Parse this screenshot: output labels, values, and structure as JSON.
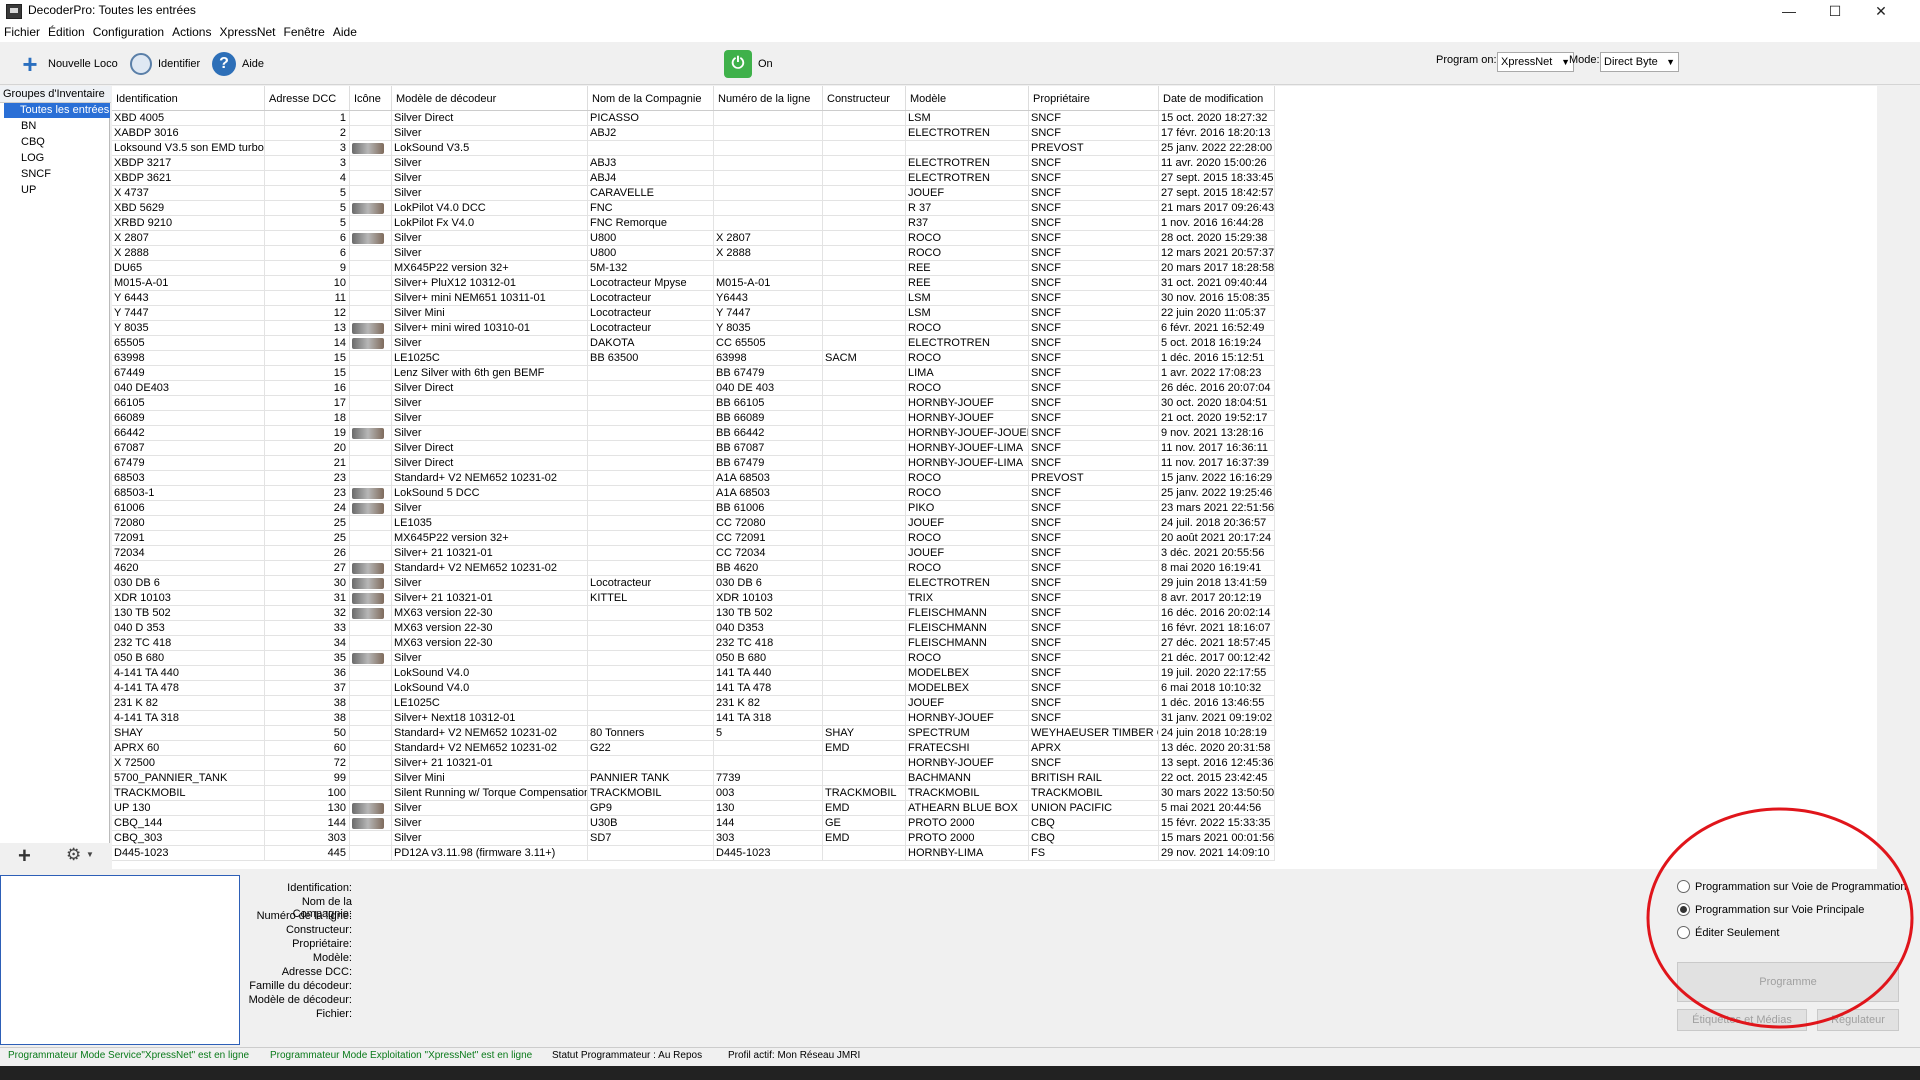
{
  "window": {
    "title": "DecoderPro: Toutes les entrées"
  },
  "menu": [
    "Fichier",
    "Édition",
    "Configuration",
    "Actions",
    "XpressNet",
    "Fenêtre",
    "Aide"
  ],
  "toolbar": {
    "new_loco": "Nouvelle Loco",
    "identify": "Identifier",
    "help": "Aide",
    "power": "On",
    "program_on_label": "Program on:",
    "program_on_value": "XpressNet",
    "mode_label": "Mode:",
    "mode_value": "Direct Byte"
  },
  "groups": {
    "header": "Groupes d'Inventaire",
    "items": [
      "Toutes les entrées",
      "BN",
      "CBQ",
      "LOG",
      "SNCF",
      "UP"
    ]
  },
  "table": {
    "columns": [
      "Identification",
      "Adresse DCC",
      "Icône",
      "Modèle de décodeur",
      "Nom de la Compagnie",
      "Numéro de la ligne",
      "Constructeur",
      "Modèle",
      "Propriétaire",
      "Date de modification"
    ],
    "rows": [
      [
        "XBD 4005",
        "1",
        "",
        "Silver Direct",
        "PICASSO",
        "",
        "",
        "LSM",
        "SNCF",
        "15 oct. 2020 18:27:32"
      ],
      [
        "XABDP 3016",
        "2",
        "",
        "Silver",
        "ABJ2",
        "",
        "",
        "ELECTROTREN",
        "SNCF",
        "17 févr. 2016 18:20:13"
      ],
      [
        "Loksound V3.5 son EMD turbo",
        "3",
        "img",
        "LokSound V3.5",
        "",
        "",
        "",
        "",
        "PREVOST",
        "25 janv. 2022 22:28:00"
      ],
      [
        "XBDP 3217",
        "3",
        "",
        "Silver",
        "ABJ3",
        "",
        "",
        "ELECTROTREN",
        "SNCF",
        "11 avr. 2020 15:00:26"
      ],
      [
        "XBDP 3621",
        "4",
        "",
        "Silver",
        "ABJ4",
        "",
        "",
        "ELECTROTREN",
        "SNCF",
        "27 sept. 2015 18:33:45"
      ],
      [
        "X 4737",
        "5",
        "",
        "Silver",
        "CARAVELLE",
        "",
        "",
        "JOUEF",
        "SNCF",
        "27 sept. 2015 18:42:57"
      ],
      [
        "XBD 5629",
        "5",
        "img",
        "LokPilot V4.0 DCC",
        "FNC",
        "",
        "",
        "R 37",
        "SNCF",
        "21 mars 2017 09:26:43"
      ],
      [
        "XRBD 9210",
        "5",
        "",
        "LokPilot Fx V4.0",
        "FNC Remorque",
        "",
        "",
        "R37",
        "SNCF",
        "1 nov. 2016 16:44:28"
      ],
      [
        "X 2807",
        "6",
        "img",
        "Silver",
        "U800",
        "X 2807",
        "",
        "ROCO",
        "SNCF",
        "28 oct. 2020 15:29:38"
      ],
      [
        "X 2888",
        "6",
        "",
        "Silver",
        "U800",
        "X 2888",
        "",
        "ROCO",
        "SNCF",
        "12 mars 2021 20:57:37"
      ],
      [
        "DU65",
        "9",
        "",
        "MX645P22 version 32+",
        "5M-132",
        "",
        "",
        "REE",
        "SNCF",
        "20 mars 2017 18:28:58"
      ],
      [
        "M015-A-01",
        "10",
        "",
        "Silver+ PluX12 10312-01",
        "Locotracteur Mpyse",
        "M015-A-01",
        "",
        "REE",
        "SNCF",
        "31 oct. 2021 09:40:44"
      ],
      [
        "Y 6443",
        "11",
        "",
        "Silver+ mini NEM651 10311-01",
        "Locotracteur",
        "Y6443",
        "",
        "LSM",
        "SNCF",
        "30 nov. 2016 15:08:35"
      ],
      [
        "Y 7447",
        "12",
        "",
        "Silver Mini",
        "Locotracteur",
        "Y 7447",
        "",
        "LSM",
        "SNCF",
        "22 juin 2020 11:05:37"
      ],
      [
        "Y 8035",
        "13",
        "img",
        "Silver+ mini wired 10310-01",
        "Locotracteur",
        "Y 8035",
        "",
        "ROCO",
        "SNCF",
        "6 févr. 2021 16:52:49"
      ],
      [
        "65505",
        "14",
        "img",
        "Silver",
        "DAKOTA",
        "CC 65505",
        "",
        "ELECTROTREN",
        "SNCF",
        "5 oct. 2018 16:19:24"
      ],
      [
        "63998",
        "15",
        "",
        "LE1025C",
        "BB 63500",
        "63998",
        "SACM",
        "ROCO",
        "SNCF",
        "1 déc. 2016 15:12:51"
      ],
      [
        "67449",
        "15",
        "",
        "Lenz Silver with 6th gen BEMF",
        "",
        "BB 67479",
        "",
        "LIMA",
        "SNCF",
        "1 avr. 2022 17:08:23"
      ],
      [
        "040 DE403",
        "16",
        "",
        "Silver Direct",
        "",
        "040 DE 403",
        "",
        "ROCO",
        "SNCF",
        "26 déc. 2016 20:07:04"
      ],
      [
        "66105",
        "17",
        "",
        "Silver",
        "",
        "BB 66105",
        "",
        "HORNBY-JOUEF",
        "SNCF",
        "30 oct. 2020 18:04:51"
      ],
      [
        "66089",
        "18",
        "",
        "Silver",
        "",
        "BB 66089",
        "",
        "HORNBY-JOUEF",
        "SNCF",
        "21 oct. 2020 19:52:17"
      ],
      [
        "66442",
        "19",
        "img",
        "Silver",
        "",
        "BB 66442",
        "",
        "HORNBY-JOUEF-JOUEF",
        "SNCF",
        "9 nov. 2021 13:28:16"
      ],
      [
        "67087",
        "20",
        "",
        "Silver Direct",
        "",
        "BB 67087",
        "",
        "HORNBY-JOUEF-LIMA",
        "SNCF",
        "11 nov. 2017 16:36:11"
      ],
      [
        "67479",
        "21",
        "",
        "Silver Direct",
        "",
        "BB 67479",
        "",
        "HORNBY-JOUEF-LIMA",
        "SNCF",
        "11 nov. 2017 16:37:39"
      ],
      [
        "68503",
        "23",
        "",
        "Standard+ V2 NEM652 10231-02",
        "",
        "A1A 68503",
        "",
        "ROCO",
        "PREVOST",
        "15 janv. 2022 16:16:29"
      ],
      [
        "68503-1",
        "23",
        "img",
        "LokSound 5 DCC",
        "",
        "A1A 68503",
        "",
        "ROCO",
        "SNCF",
        "25 janv. 2022 19:25:46"
      ],
      [
        "61006",
        "24",
        "img",
        "Silver",
        "",
        "BB 61006",
        "",
        "PIKO",
        "SNCF",
        "23 mars 2021 22:51:56"
      ],
      [
        "72080",
        "25",
        "",
        "LE1035",
        "",
        "CC 72080",
        "",
        "JOUEF",
        "SNCF",
        "24 juil. 2018 20:36:57"
      ],
      [
        "72091",
        "25",
        "",
        "MX645P22 version 32+",
        "",
        "CC 72091",
        "",
        "ROCO",
        "SNCF",
        "20 août 2021 20:17:24"
      ],
      [
        "72034",
        "26",
        "",
        "Silver+ 21 10321-01",
        "",
        "CC 72034",
        "",
        "JOUEF",
        "SNCF",
        "3 déc. 2021 20:55:56"
      ],
      [
        "4620",
        "27",
        "img",
        "Standard+ V2 NEM652 10231-02",
        "",
        "BB 4620",
        "",
        "ROCO",
        "SNCF",
        "8 mai 2020 16:19:41"
      ],
      [
        "030 DB 6",
        "30",
        "img",
        "Silver",
        "Locotracteur",
        "030 DB 6",
        "",
        "ELECTROTREN",
        "SNCF",
        "29 juin 2018 13:41:59"
      ],
      [
        "XDR 10103",
        "31",
        "img",
        "Silver+ 21 10321-01",
        "KITTEL",
        "XDR 10103",
        "",
        "TRIX",
        "SNCF",
        "8 avr. 2017 20:12:19"
      ],
      [
        "130 TB 502",
        "32",
        "img",
        "MX63 version 22-30",
        "",
        "130 TB 502",
        "",
        "FLEISCHMANN",
        "SNCF",
        "16 déc. 2016 20:02:14"
      ],
      [
        "040 D 353",
        "33",
        "",
        "MX63 version 22-30",
        "",
        "040 D353",
        "",
        "FLEISCHMANN",
        "SNCF",
        "16 févr. 2021 18:16:07"
      ],
      [
        "232 TC 418",
        "34",
        "",
        "MX63 version 22-30",
        "",
        "232 TC 418",
        "",
        "FLEISCHMANN",
        "SNCF",
        "27 déc. 2021 18:57:45"
      ],
      [
        "050 B 680",
        "35",
        "img",
        "Silver",
        "",
        "050 B 680",
        "",
        "ROCO",
        "SNCF",
        "21 déc. 2017 00:12:42"
      ],
      [
        "4-141 TA 440",
        "36",
        "",
        "LokSound V4.0",
        "",
        "141 TA 440",
        "",
        "MODELBEX",
        "SNCF",
        "19 juil. 2020 22:17:55"
      ],
      [
        "4-141 TA 478",
        "37",
        "",
        "LokSound V4.0",
        "",
        "141 TA 478",
        "",
        "MODELBEX",
        "SNCF",
        "6 mai 2018 10:10:32"
      ],
      [
        "231 K 82",
        "38",
        "",
        "LE1025C",
        "",
        "231 K 82",
        "",
        "JOUEF",
        "SNCF",
        "1 déc. 2016 13:46:55"
      ],
      [
        "4-141 TA 318",
        "38",
        "",
        "Silver+ Next18 10312-01",
        "",
        "141 TA 318",
        "",
        "HORNBY-JOUEF",
        "SNCF",
        "31 janv. 2021 09:19:02"
      ],
      [
        "SHAY",
        "50",
        "",
        "Standard+ V2 NEM652 10231-02",
        "80 Tonners",
        "5",
        "SHAY",
        "SPECTRUM",
        "WEYHAEUSER TIMBER Co",
        "24 juin 2018 10:28:19"
      ],
      [
        "APRX 60",
        "60",
        "",
        "Standard+ V2 NEM652 10231-02",
        "G22",
        "",
        "EMD",
        "FRATECSHI",
        "APRX",
        "13 déc. 2020 20:31:58"
      ],
      [
        "X 72500",
        "72",
        "",
        "Silver+ 21 10321-01",
        "",
        "",
        "",
        "HORNBY-JOUEF",
        "SNCF",
        "13 sept. 2016 12:45:36"
      ],
      [
        "5700_PANNIER_TANK",
        "99",
        "",
        "Silver Mini",
        "PANNIER TANK",
        "7739",
        "",
        "BACHMANN",
        "BRITISH RAIL",
        "22 oct. 2015 23:42:45"
      ],
      [
        "TRACKMOBIL",
        "100",
        "",
        "Silent Running w/ Torque Compensation",
        "TRACKMOBIL",
        "003",
        "TRACKMOBIL",
        "TRACKMOBIL",
        "TRACKMOBIL",
        "30 mars 2022 13:50:50"
      ],
      [
        "UP 130",
        "130",
        "img",
        "Silver",
        "GP9",
        "130",
        "EMD",
        "ATHEARN BLUE BOX",
        "UNION PACIFIC",
        "5 mai 2021 20:44:56"
      ],
      [
        "CBQ_144",
        "144",
        "img",
        "Silver",
        "U30B",
        "144",
        "GE",
        "PROTO 2000",
        "CBQ",
        "15 févr. 2022 15:33:35"
      ],
      [
        "CBQ_303",
        "303",
        "",
        "Silver",
        "SD7",
        "303",
        "EMD",
        "PROTO 2000",
        "CBQ",
        "15 mars 2021 00:01:56"
      ],
      [
        "D445-1023",
        "445",
        "",
        "PD12A v3.11.98 (firmware 3.11+)",
        "",
        "D445-1023",
        "",
        "HORNBY-LIMA",
        "FS",
        "29 nov. 2021 14:09:10"
      ]
    ]
  },
  "details": {
    "labels": [
      "Identification:",
      "Nom de la Compagnie:",
      "Numéro de la ligne:",
      "Constructeur:",
      "Propriétaire:",
      "Modèle:",
      "Adresse DCC:",
      "Famille du décodeur:",
      "Modèle de décodeur:",
      "Fichier:"
    ]
  },
  "programming": {
    "options": [
      "Programmation sur Voie de Programmation",
      "Programmation sur Voie Principale",
      "Éditer Seulement"
    ],
    "selected_index": 1,
    "program_button": "Programme",
    "labels_button": "Étiquettes et Médias",
    "throttle_button": "Régulateur"
  },
  "status": {
    "service_mode": "Programmateur Mode Service\"XpressNet\" est en ligne",
    "ops_mode": "Programmateur Mode Exploitation \"XpressNet\" est en ligne",
    "programmer_status": "Statut Programmateur : Au Repos",
    "active_profile": "Profil actif: Mon Réseau JMRI"
  },
  "colors": {
    "selection": "#2a6fd6",
    "annotation_circle": "#e0151b",
    "status_green": "#0a7a1a"
  }
}
